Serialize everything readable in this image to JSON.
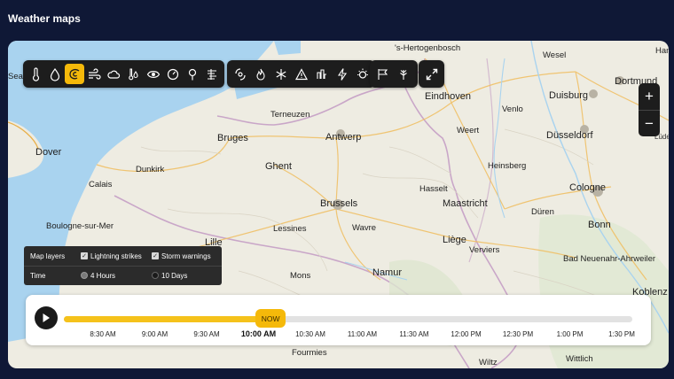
{
  "page": {
    "title": "Weather maps"
  },
  "map": {
    "cities": [
      {
        "name": "Bruges",
        "cls": "big"
      },
      {
        "name": "Antwerp",
        "cls": "big"
      },
      {
        "name": "Ghent",
        "cls": "big"
      },
      {
        "name": "Brussels",
        "cls": "big"
      },
      {
        "name": "Eindhoven",
        "cls": "big"
      },
      {
        "name": "Duisburg",
        "cls": "big"
      },
      {
        "name": "Dortmund",
        "cls": "big"
      },
      {
        "name": "Düsseldorf",
        "cls": "big"
      },
      {
        "name": "Cologne",
        "cls": "big"
      },
      {
        "name": "Bonn",
        "cls": "big"
      },
      {
        "name": "Maastricht",
        "cls": "big"
      },
      {
        "name": "Liège",
        "cls": "big"
      },
      {
        "name": "Namur",
        "cls": "big"
      },
      {
        "name": "Dover",
        "cls": "big"
      },
      {
        "name": "Lille",
        "cls": "big"
      },
      {
        "name": "Koblenz",
        "cls": "big"
      },
      {
        "name": "'s-Hertogenbosch",
        "cls": "med"
      },
      {
        "name": "Terneuzen",
        "cls": "med"
      },
      {
        "name": "Dunkirk",
        "cls": "med"
      },
      {
        "name": "Calais",
        "cls": "med"
      },
      {
        "name": "Boulogne-sur-Mer",
        "cls": "med"
      },
      {
        "name": "Lessines",
        "cls": "med"
      },
      {
        "name": "Wavre",
        "cls": "med"
      },
      {
        "name": "Mons",
        "cls": "med"
      },
      {
        "name": "Hasselt",
        "cls": "med"
      },
      {
        "name": "Venlo",
        "cls": "med"
      },
      {
        "name": "Weert",
        "cls": "med"
      },
      {
        "name": "Heinsberg",
        "cls": "med"
      },
      {
        "name": "Düren",
        "cls": "med"
      },
      {
        "name": "Verviers",
        "cls": "med"
      },
      {
        "name": "Bad Neuenahr-Ahrweiler",
        "cls": "med"
      },
      {
        "name": "Wesel",
        "cls": "med"
      },
      {
        "name": "Fourmies",
        "cls": "med"
      },
      {
        "name": "Wittlich",
        "cls": "med"
      },
      {
        "name": "Wiltz",
        "cls": "med"
      },
      {
        "name": "Lüdenscheid",
        "cls": "small"
      },
      {
        "name": "Ham",
        "cls": "med"
      },
      {
        "name": "Sea",
        "cls": "med"
      }
    ]
  },
  "toolbar": {
    "group1": [
      "thermometer-icon",
      "raindrop-icon",
      "storm-swirl-icon",
      "wind-icon",
      "cloud-icon",
      "temperature-drops-icon",
      "eye-visibility-icon",
      "pressure-gauge-icon",
      "location-pin-icon",
      "fog-lines-icon"
    ],
    "group2": [
      "hurricane-icon",
      "fire-icon",
      "snowflake-icon",
      "warning-triangle-icon",
      "air-quality-icon",
      "lightning-icon",
      "sun-alert-icon"
    ],
    "group3": [
      "wind-flag-icon",
      "pollen-leaf-icon"
    ],
    "group4": [
      "expand-icon"
    ],
    "active_icon": "storm-swirl-icon",
    "icon_color": "#ffffff",
    "active_color": "#f5b90a"
  },
  "zoom": {
    "in_label": "+",
    "out_label": "−"
  },
  "layers_panel": {
    "map_layers_label": "Map layers",
    "lightning_label": "Lightning strikes",
    "storm_label": "Storm warnings",
    "lightning_checked": true,
    "storm_checked": true,
    "time_label": "Time",
    "hours_label": "4 Hours",
    "days_label": "10 Days",
    "selected_time": "4 Hours"
  },
  "timeline": {
    "now_label": "NOW",
    "progress_fraction": 0.37,
    "current_time": "10:00 AM",
    "ticks": [
      "8:30 AM",
      "9:00 AM",
      "9:30 AM",
      "10:00 AM",
      "10:30 AM",
      "11:00 AM",
      "11:30 AM",
      "12:00 PM",
      "12:30 PM",
      "1:00 PM",
      "1:30 PM"
    ],
    "accent_color": "#f5c21b"
  }
}
